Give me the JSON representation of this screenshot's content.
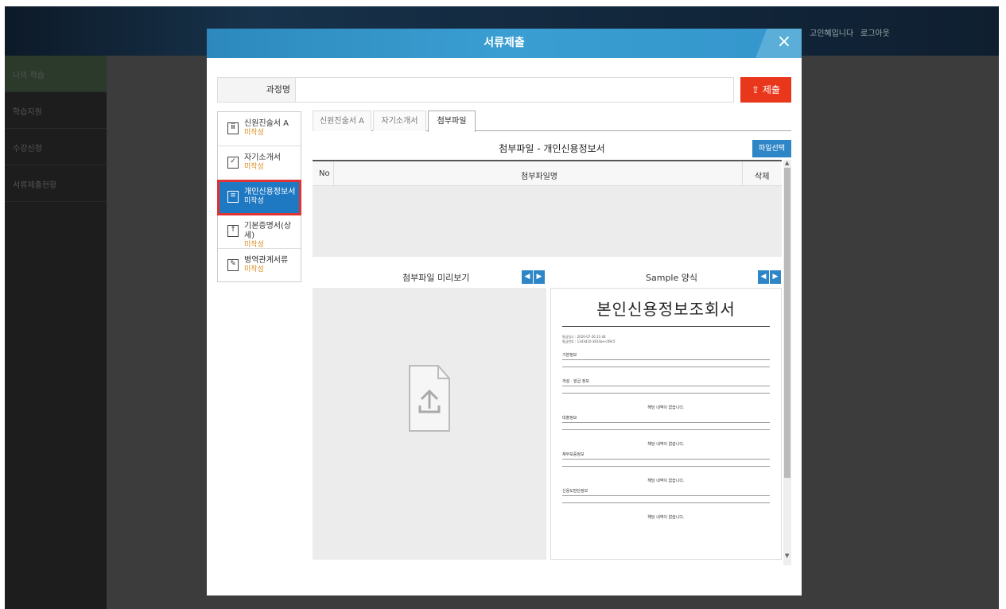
{
  "top": {
    "user_text": "고인혜입니다",
    "logout_label": "로그아웃"
  },
  "sidebar": {
    "items": [
      "나의 학습",
      "학습지원",
      "수강신청",
      "서류제출현황"
    ]
  },
  "modal": {
    "title": "서류제출",
    "course_label": "과정명",
    "course_value": "",
    "submit_label": "제출",
    "documents": [
      {
        "name": "신원진술서 A",
        "status": "미작성",
        "icon": "id-doc-icon",
        "selected": false
      },
      {
        "name": "자기소개서",
        "status": "미작성",
        "icon": "checkbox-icon",
        "selected": false
      },
      {
        "name": "개인신용정보서",
        "status": "미작성",
        "icon": "document-icon",
        "selected": true
      },
      {
        "name": "기본증명서(상세)",
        "status": "미작성",
        "icon": "upload-box-icon",
        "selected": false
      },
      {
        "name": "병역관계서류",
        "status": "미작성",
        "icon": "edit-icon",
        "selected": false
      }
    ],
    "tabs": [
      {
        "label": "신원진술서 A",
        "active": false
      },
      {
        "label": "자기소개서",
        "active": false
      },
      {
        "label": "첨부파일",
        "active": true
      }
    ],
    "attach_title": "첨부파일 - 개인신용정보서",
    "file_select_label": "파일선택",
    "table_headers": {
      "no": "No",
      "name": "첨부파일명",
      "delete": "삭제"
    },
    "preview_label": "첨부파일 미리보기",
    "sample_label": "Sample 양식",
    "sample": {
      "title": "본인신용정보조회서",
      "meta1": "발급일시 : 2020-07-26 21:44",
      "meta2": "발급번호 : 1343d10-3814ae-c09c5",
      "sections": [
        "기본정보",
        "개설 · 발급 정보",
        "대출정보",
        "채무보증정보",
        "신용도판단정보"
      ],
      "empty_row": "해당 내역이 없습니다."
    }
  },
  "colors": {
    "accent": "#2f86c6",
    "submit": "#e9371c",
    "status": "#d98a1c",
    "header": "#3496cc"
  }
}
